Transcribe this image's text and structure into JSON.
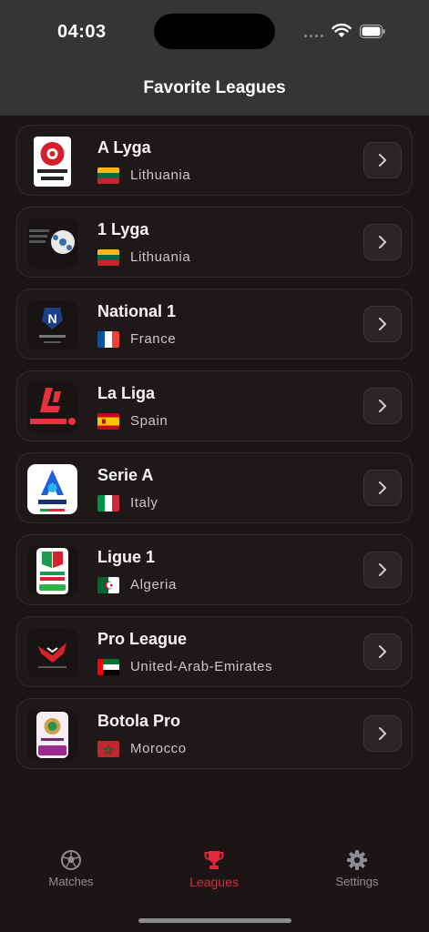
{
  "status": {
    "time": "04:03"
  },
  "header": {
    "title": "Favorite Leagues"
  },
  "leagues": [
    {
      "name": "A Lyga",
      "country": "Lithuania",
      "logo_text": "OPTIBET A LYGA"
    },
    {
      "name": "1 Lyga",
      "country": "Lithuania",
      "logo_text": "OPTIBET PIRMA LYGA"
    },
    {
      "name": "National 1",
      "country": "France",
      "logo_text": "NATIONAL"
    },
    {
      "name": "La Liga",
      "country": "Spain",
      "logo_text": "LALIGA"
    },
    {
      "name": "Serie A",
      "country": "Italy",
      "logo_text": "SERIE A"
    },
    {
      "name": "Ligue 1",
      "country": "Algeria",
      "logo_text": "LIGUE 1 mobilis"
    },
    {
      "name": "Pro League",
      "country": "United-Arab-Emirates",
      "logo_text": ""
    },
    {
      "name": "Botola Pro",
      "country": "Morocco",
      "logo_text": "BOTOLA PRO inwi"
    }
  ],
  "tabs": [
    {
      "label": "Matches",
      "icon": "soccer-ball-icon",
      "active": false
    },
    {
      "label": "Leagues",
      "icon": "trophy-icon",
      "active": true
    },
    {
      "label": "Settings",
      "icon": "gear-icon",
      "active": false
    }
  ],
  "colors": {
    "accent": "#e0283c",
    "background": "#1b1515",
    "header": "#353535"
  }
}
